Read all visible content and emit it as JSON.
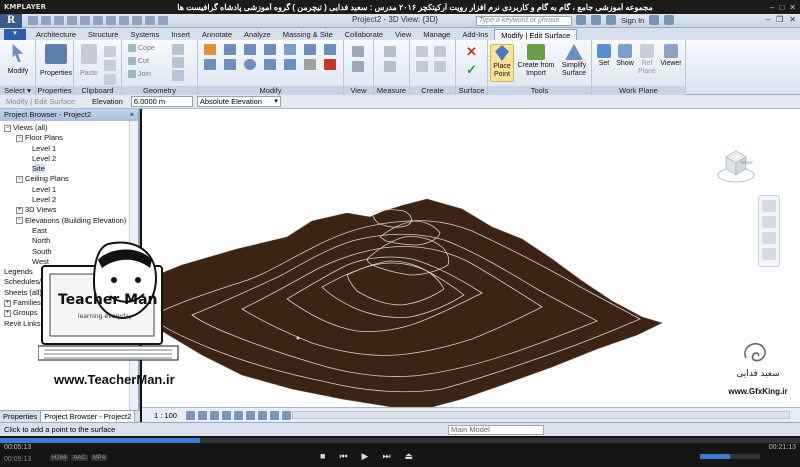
{
  "player": {
    "name": "KMPLAYER",
    "caption": "مجموعه آموزشی جامع ، گام به گام و کاربردی نرم افزار رویت آرکیتکچر ۲۰۱۶ مدرس : سعید فدایی ( تیچرمن ) گروه آموزشی پادشاه گرافیست ها",
    "time_current": "00:05:13",
    "time_total": "00:21:13",
    "time_small": "00:05:13",
    "formats": [
      "H264",
      "AAC",
      "MP4"
    ],
    "progress": 0.25,
    "volume": 0.5
  },
  "app": {
    "logo": "R",
    "title": "Project2 - 3D View: {3D}",
    "search_placeholder": "Type a keyword or phrase",
    "sign_in": "Sign In"
  },
  "tabs": [
    "Architecture",
    "Structure",
    "Systems",
    "Insert",
    "Annotate",
    "Analyze",
    "Massing & Site",
    "Collaborate",
    "View",
    "Manage",
    "Add-Ins",
    "Modify | Edit Surface"
  ],
  "ribbon": {
    "modify": "Modify",
    "properties": "Properties",
    "paste": "Paste",
    "cope": "Cope",
    "cut": "Cut",
    "join": "Join",
    "place_point": "Place Point",
    "create_from_import": "Create from Import",
    "simplify_surface": "Simplify Surface",
    "set": "Set",
    "show": "Show",
    "ref_plane": "Ref Plane",
    "viewer": "Viewer",
    "panels": {
      "select": "Select ▾",
      "properties": "Properties",
      "clipboard": "Clipboard",
      "geometry": "Geometry",
      "modify": "Modify",
      "view": "View",
      "measure": "Measure",
      "create": "Create",
      "surface": "Surface",
      "tools": "Tools",
      "work_plane": "Work Plane"
    }
  },
  "options_bar": {
    "mode": "Modify | Edit Surface",
    "elevation_label": "Elevation",
    "elevation_value": "6.0000 m",
    "elevation_type": "Absolute Elevation"
  },
  "browser": {
    "title": "Project Browser - Project2",
    "close": "×",
    "tree": [
      {
        "label": "Views (all)",
        "level": 0,
        "toggle": "−"
      },
      {
        "label": "Floor Plans",
        "level": 1,
        "toggle": "−"
      },
      {
        "label": "Level 1",
        "level": 2,
        "toggle": ""
      },
      {
        "label": "Level 2",
        "level": 2,
        "toggle": ""
      },
      {
        "label": "Site",
        "level": 2,
        "toggle": ""
      },
      {
        "label": "Ceiling Plans",
        "level": 1,
        "toggle": "−"
      },
      {
        "label": "Level 1",
        "level": 2,
        "toggle": ""
      },
      {
        "label": "Level 2",
        "level": 2,
        "toggle": ""
      },
      {
        "label": "3D Views",
        "level": 1,
        "toggle": "+"
      },
      {
        "label": "Elevations (Building Elevation)",
        "level": 1,
        "toggle": "−"
      },
      {
        "label": "East",
        "level": 2,
        "toggle": ""
      },
      {
        "label": "North",
        "level": 2,
        "toggle": ""
      },
      {
        "label": "South",
        "level": 2,
        "toggle": ""
      },
      {
        "label": "West",
        "level": 2,
        "toggle": ""
      },
      {
        "label": "Legends",
        "level": 0,
        "toggle": ""
      },
      {
        "label": "Schedules/Quantities",
        "level": 0,
        "toggle": ""
      },
      {
        "label": "Sheets (all)",
        "level": 0,
        "toggle": ""
      },
      {
        "label": "Families",
        "level": 0,
        "toggle": "+"
      },
      {
        "label": "Groups",
        "level": 0,
        "toggle": "+"
      },
      {
        "label": "Revit Links",
        "level": 0,
        "toggle": ""
      }
    ],
    "tab_properties": "Properties",
    "tab_browser": "Project Browser - Project2"
  },
  "viewbar": {
    "scale": "1 : 100"
  },
  "viewcube": {
    "face": "FRONT"
  },
  "status": {
    "message": "Click to add a point to the surface",
    "model": "Main Model"
  },
  "watermark": {
    "brand": "Teacher Man",
    "brand_sub": "learning everyday",
    "url": "www.TeacherMan.ir",
    "author": "سعید فدایی",
    "site": "www.GfxKing.ir"
  },
  "colors": {
    "topo_fill": "#3b2414",
    "contour": "#d8d0c8",
    "active_tab": "#f4f7fb",
    "accent": "#2c5db1"
  }
}
